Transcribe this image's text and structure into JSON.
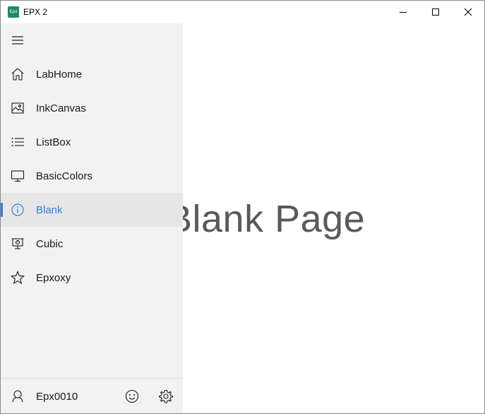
{
  "window": {
    "title": "EPX 2",
    "app_icon_text": "Epx",
    "controls": [
      "minimize",
      "maximize",
      "close"
    ]
  },
  "nav": {
    "menu_icon": "hamburger-icon",
    "items": [
      {
        "label": "LabHome",
        "icon": "home-icon"
      },
      {
        "label": "InkCanvas",
        "icon": "picture-icon"
      },
      {
        "label": "ListBox",
        "icon": "list-icon"
      },
      {
        "label": "BasicColors",
        "icon": "monitor-icon"
      },
      {
        "label": "Blank",
        "icon": "info-icon",
        "selected": true
      },
      {
        "label": "Cubic",
        "icon": "presentation-icon"
      },
      {
        "label": "Epxoxy",
        "icon": "star-icon"
      }
    ],
    "footer": {
      "user_label": "Epx0010",
      "user_icon": "person-icon",
      "emoji_icon": "smiley-icon",
      "settings_icon": "gear-icon"
    }
  },
  "main": {
    "heading": "Blank Page"
  },
  "colors": {
    "accent": "#2f7de1",
    "nav_background": "#f2f2f2",
    "app_icon": "#1f8a6b"
  }
}
